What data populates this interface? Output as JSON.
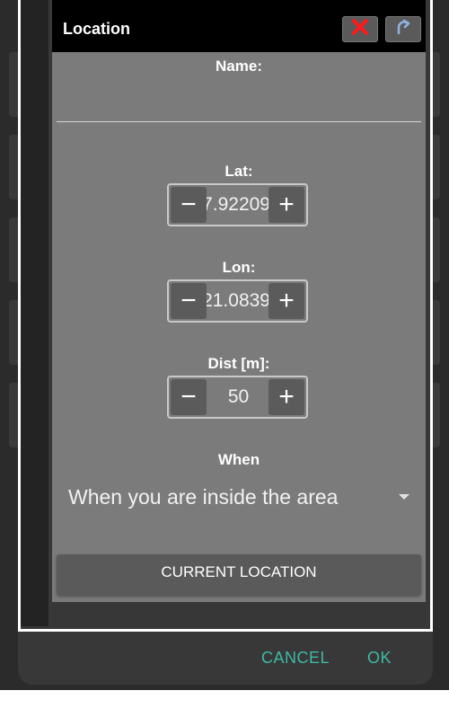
{
  "dialog": {
    "title": "Location",
    "close_icon_color": "#ff1a1a",
    "redo_icon_color": "#8fb3e6"
  },
  "form": {
    "name_label": "Name:",
    "name_value": "",
    "lat_label": "Lat:",
    "lat_value": "7.92209",
    "lon_label": "Lon:",
    "lon_value": "21.0839",
    "dist_label": "Dist [m]:",
    "dist_value": "50",
    "minus_symbol": "−",
    "plus_symbol": "+",
    "when_label": "When",
    "when_value": "When you are inside the area",
    "current_location_button": "CURRENT LOCATION"
  },
  "footer": {
    "cancel_label": "CANCEL",
    "ok_label": "OK",
    "accent_color": "#3fb9a6"
  }
}
